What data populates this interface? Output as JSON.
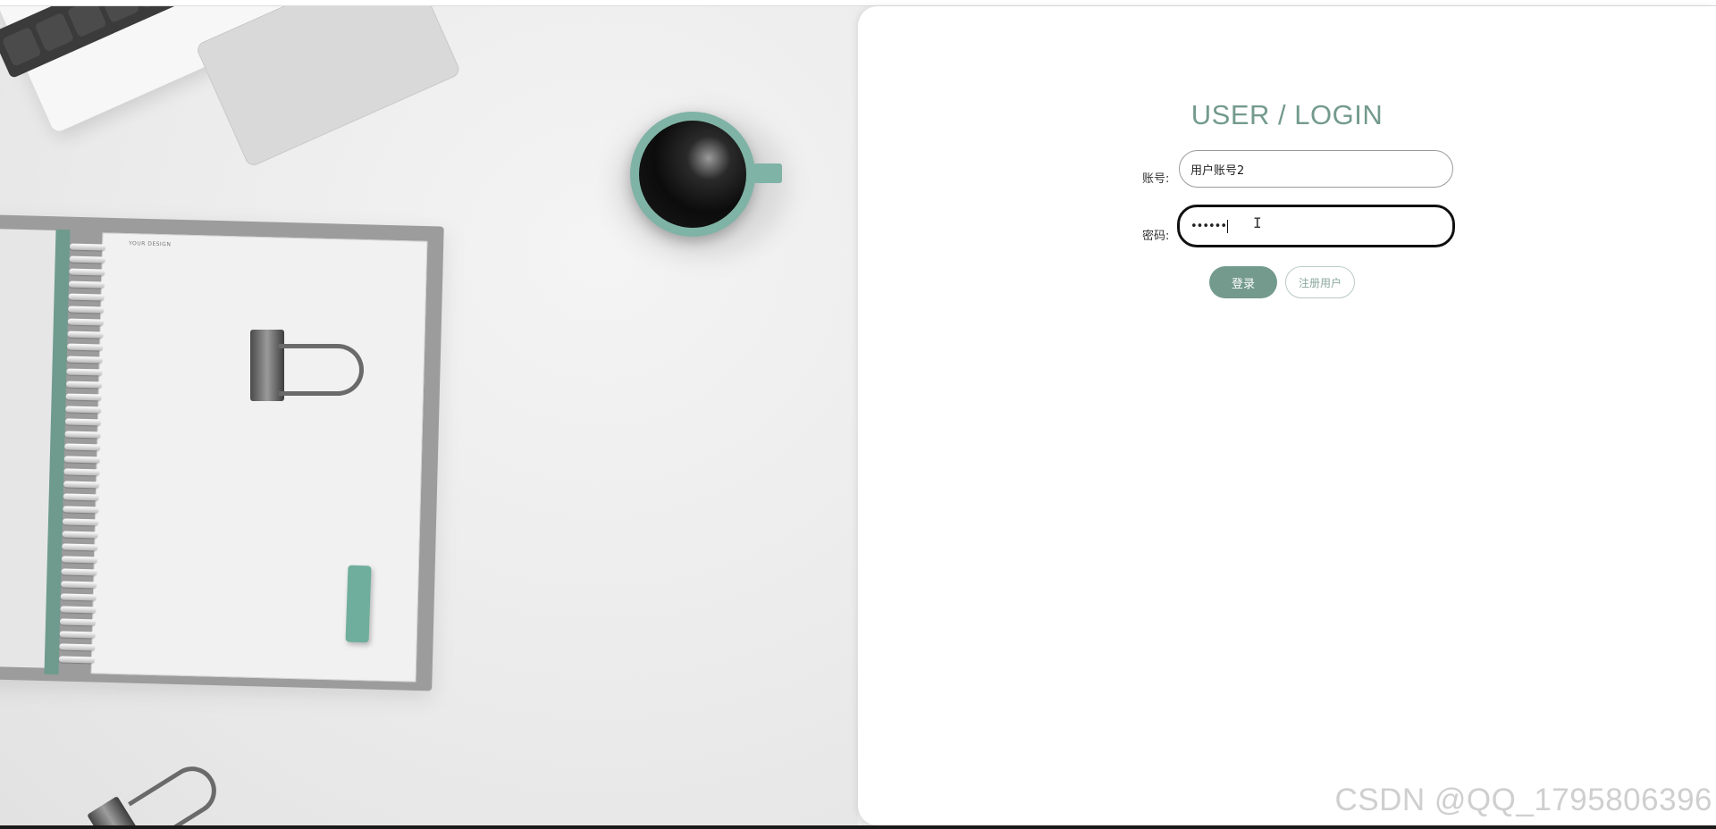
{
  "login": {
    "title": "USER / LOGIN",
    "account_label": "账号:",
    "account_value": "用户账号2",
    "password_label": "密码:",
    "password_masked": "••••••",
    "login_button": "登录",
    "register_button": "注册用户"
  },
  "background": {
    "notebook_brand_text": "YOUR DESIGN"
  },
  "watermark": "CSDN @QQ_1795806396",
  "colors": {
    "accent": "#739a8d",
    "panel_bg": "#ffffff",
    "scene_bg": "#ececec",
    "teal_objects": "#7fb3a5"
  },
  "icons": {
    "text_cursor": "I"
  }
}
